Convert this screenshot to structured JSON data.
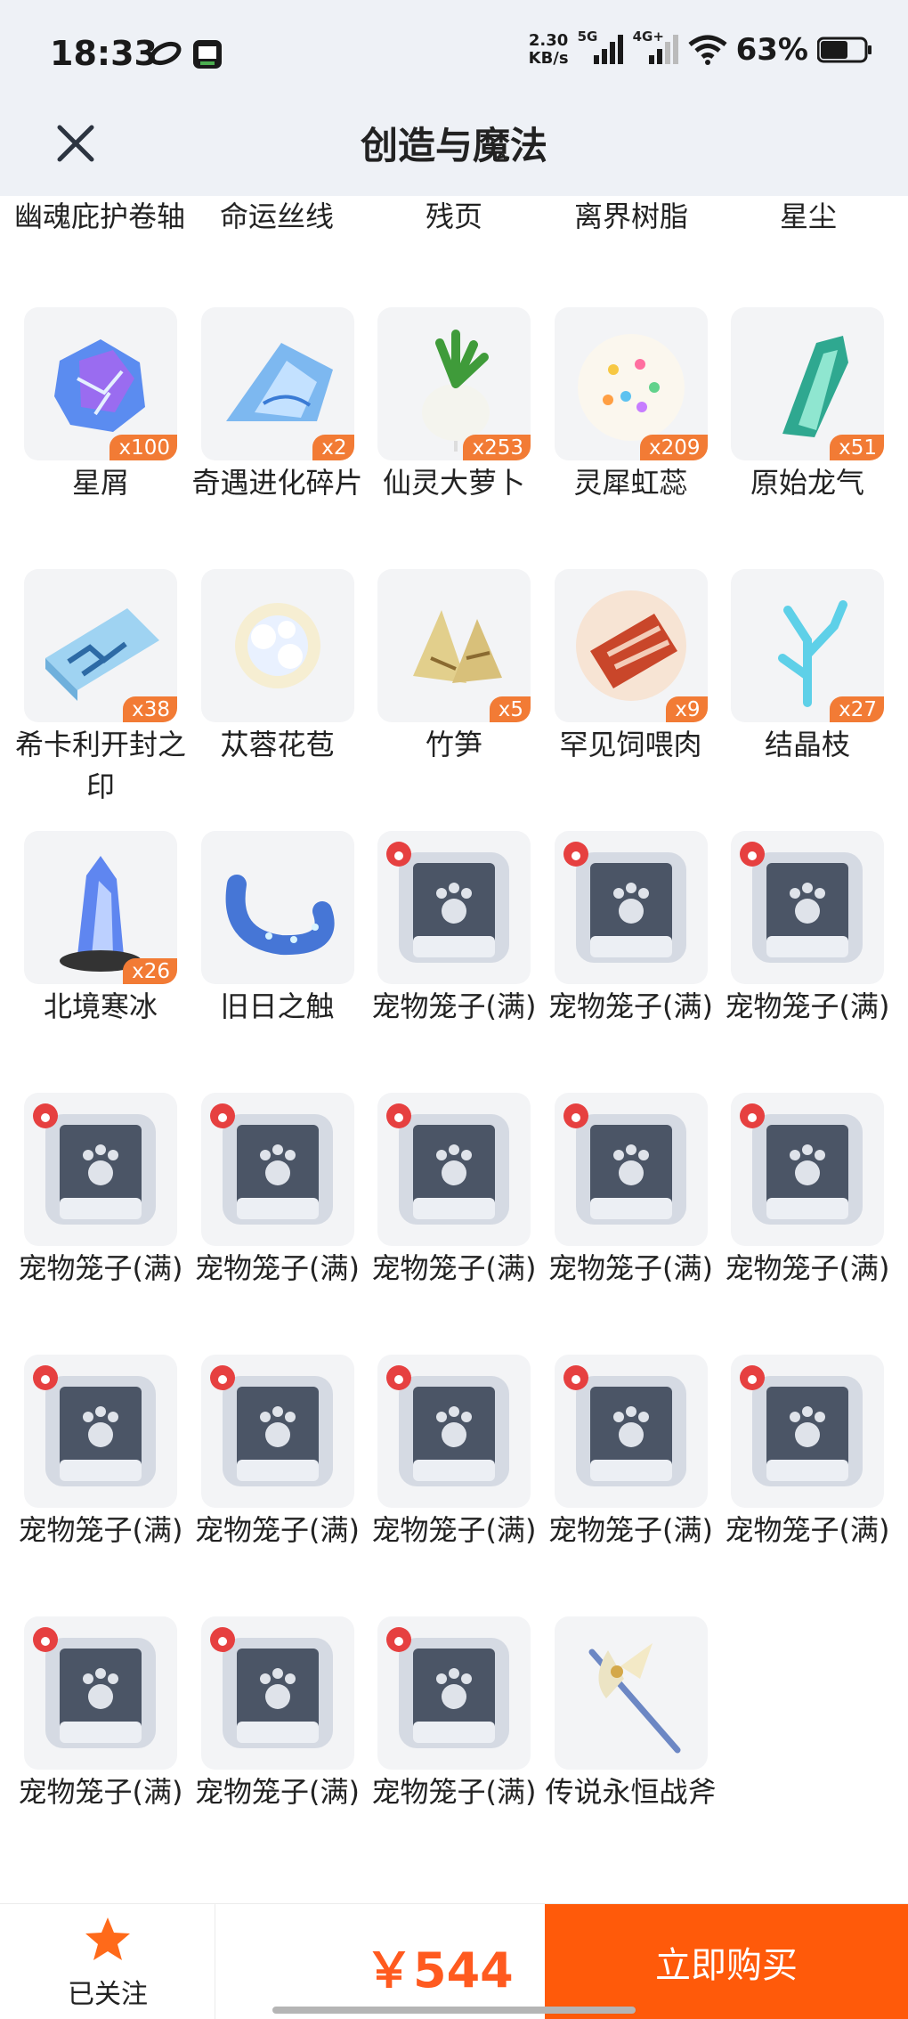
{
  "status_bar": {
    "time": "18:33",
    "net_speed_value": "2.30",
    "net_speed_unit": "KB/s",
    "signal_1": "5G",
    "signal_2": "4G+",
    "battery": "63%"
  },
  "header": {
    "title": "创造与魔法",
    "close_icon": "close-icon"
  },
  "partial_row_labels": [
    "幽魂庇护卷轴",
    "命运丝线",
    "残页",
    "离界树脂",
    "星尘"
  ],
  "items": [
    {
      "name": "星屑",
      "count": "x100",
      "icon": "star-crystal-icon"
    },
    {
      "name": "奇遇进化碎片",
      "count": "x2",
      "icon": "blue-shard-icon"
    },
    {
      "name": "仙灵大萝卜",
      "count": "x253",
      "icon": "radish-icon"
    },
    {
      "name": "灵犀虹蕊",
      "count": "x209",
      "icon": "flower-icon"
    },
    {
      "name": "原始龙气",
      "count": "x51",
      "icon": "green-crystal-icon"
    },
    {
      "name": "希卡利开封之印",
      "count": "x38",
      "icon": "seal-icon"
    },
    {
      "name": "苁蓉花苞",
      "count": "",
      "icon": "flower-bud-icon"
    },
    {
      "name": "竹笋",
      "count": "x5",
      "icon": "bamboo-shoot-icon"
    },
    {
      "name": "罕见饲喂肉",
      "count": "x9",
      "icon": "meat-icon"
    },
    {
      "name": "结晶枝",
      "count": "x27",
      "icon": "crystal-branch-icon"
    },
    {
      "name": "北境寒冰",
      "count": "x26",
      "icon": "ice-crystal-icon"
    },
    {
      "name": "旧日之触",
      "count": "",
      "icon": "tentacle-icon"
    },
    {
      "name": "宠物笼子(满)",
      "count": "",
      "icon": "pet-cage-icon"
    },
    {
      "name": "宠物笼子(满)",
      "count": "",
      "icon": "pet-cage-icon"
    },
    {
      "name": "宠物笼子(满)",
      "count": "",
      "icon": "pet-cage-icon"
    },
    {
      "name": "宠物笼子(满)",
      "count": "",
      "icon": "pet-cage-icon"
    },
    {
      "name": "宠物笼子(满)",
      "count": "",
      "icon": "pet-cage-icon"
    },
    {
      "name": "宠物笼子(满)",
      "count": "",
      "icon": "pet-cage-icon"
    },
    {
      "name": "宠物笼子(满)",
      "count": "",
      "icon": "pet-cage-icon"
    },
    {
      "name": "宠物笼子(满)",
      "count": "",
      "icon": "pet-cage-icon"
    },
    {
      "name": "宠物笼子(满)",
      "count": "",
      "icon": "pet-cage-icon"
    },
    {
      "name": "宠物笼子(满)",
      "count": "",
      "icon": "pet-cage-icon"
    },
    {
      "name": "宠物笼子(满)",
      "count": "",
      "icon": "pet-cage-icon"
    },
    {
      "name": "宠物笼子(满)",
      "count": "",
      "icon": "pet-cage-icon"
    },
    {
      "name": "宠物笼子(满)",
      "count": "",
      "icon": "pet-cage-icon"
    },
    {
      "name": "宠物笼子(满)",
      "count": "",
      "icon": "pet-cage-icon"
    },
    {
      "name": "宠物笼子(满)",
      "count": "",
      "icon": "pet-cage-icon"
    },
    {
      "name": "宠物笼子(满)",
      "count": "",
      "icon": "pet-cage-icon"
    },
    {
      "name": "传说永恒战斧",
      "count": "",
      "icon": "battle-axe-icon"
    }
  ],
  "bottom_bar": {
    "follow_label": "已关注",
    "follow_icon": "star-icon",
    "price": "￥544",
    "buy_label": "立即购买"
  },
  "colors": {
    "accent": "#ff5a0a",
    "badge": "#f27b35",
    "follow_star": "#ff6a1a",
    "price": "#ff5a1f"
  }
}
